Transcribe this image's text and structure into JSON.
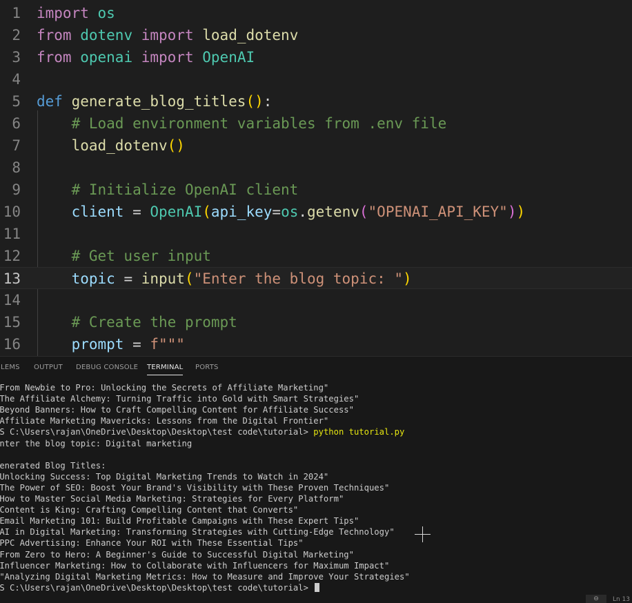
{
  "editor": {
    "current_line": 13,
    "lines": [
      {
        "number": "1",
        "tokens": [
          {
            "t": "import",
            "c": "kw-ctrl"
          },
          {
            "t": " ",
            "c": "op"
          },
          {
            "t": "os",
            "c": "mod"
          }
        ]
      },
      {
        "number": "2",
        "tokens": [
          {
            "t": "from",
            "c": "kw-ctrl"
          },
          {
            "t": " ",
            "c": "op"
          },
          {
            "t": "dotenv",
            "c": "mod"
          },
          {
            "t": " ",
            "c": "op"
          },
          {
            "t": "import",
            "c": "kw-ctrl"
          },
          {
            "t": " ",
            "c": "op"
          },
          {
            "t": "load_dotenv",
            "c": "fn"
          }
        ]
      },
      {
        "number": "3",
        "tokens": [
          {
            "t": "from",
            "c": "kw-ctrl"
          },
          {
            "t": " ",
            "c": "op"
          },
          {
            "t": "openai",
            "c": "mod"
          },
          {
            "t": " ",
            "c": "op"
          },
          {
            "t": "import",
            "c": "kw-ctrl"
          },
          {
            "t": " ",
            "c": "op"
          },
          {
            "t": "OpenAI",
            "c": "mod"
          }
        ]
      },
      {
        "number": "4",
        "tokens": []
      },
      {
        "number": "5",
        "tokens": [
          {
            "t": "def",
            "c": "kw-def"
          },
          {
            "t": " ",
            "c": "op"
          },
          {
            "t": "generate_blog_titles",
            "c": "fn"
          },
          {
            "t": "()",
            "c": "br1"
          },
          {
            "t": ":",
            "c": "op"
          }
        ]
      },
      {
        "number": "6",
        "tokens": [
          {
            "t": "    ",
            "c": "op"
          },
          {
            "t": "# Load environment variables from .env file",
            "c": "cmt"
          }
        ]
      },
      {
        "number": "7",
        "tokens": [
          {
            "t": "    ",
            "c": "op"
          },
          {
            "t": "load_dotenv",
            "c": "fn"
          },
          {
            "t": "()",
            "c": "br1"
          }
        ]
      },
      {
        "number": "8",
        "tokens": []
      },
      {
        "number": "9",
        "tokens": [
          {
            "t": "    ",
            "c": "op"
          },
          {
            "t": "# Initialize OpenAI client",
            "c": "cmt"
          }
        ]
      },
      {
        "number": "10",
        "tokens": [
          {
            "t": "    ",
            "c": "op"
          },
          {
            "t": "client",
            "c": "var"
          },
          {
            "t": " = ",
            "c": "op"
          },
          {
            "t": "OpenAI",
            "c": "mod"
          },
          {
            "t": "(",
            "c": "br1"
          },
          {
            "t": "api_key",
            "c": "var"
          },
          {
            "t": "=",
            "c": "op"
          },
          {
            "t": "os",
            "c": "mod"
          },
          {
            "t": ".",
            "c": "op"
          },
          {
            "t": "getenv",
            "c": "fn"
          },
          {
            "t": "(",
            "c": "br2"
          },
          {
            "t": "\"OPENAI_API_KEY\"",
            "c": "str"
          },
          {
            "t": ")",
            "c": "br2"
          },
          {
            "t": ")",
            "c": "br1"
          }
        ]
      },
      {
        "number": "11",
        "tokens": []
      },
      {
        "number": "12",
        "tokens": [
          {
            "t": "    ",
            "c": "op"
          },
          {
            "t": "# Get user input",
            "c": "cmt"
          }
        ]
      },
      {
        "number": "13",
        "tokens": [
          {
            "t": "    ",
            "c": "op"
          },
          {
            "t": "topic",
            "c": "var"
          },
          {
            "t": " = ",
            "c": "op"
          },
          {
            "t": "input",
            "c": "fn"
          },
          {
            "t": "(",
            "c": "br1"
          },
          {
            "t": "\"Enter the blog topic: \"",
            "c": "str"
          },
          {
            "t": ")",
            "c": "br1"
          }
        ]
      },
      {
        "number": "14",
        "tokens": []
      },
      {
        "number": "15",
        "tokens": [
          {
            "t": "    ",
            "c": "op"
          },
          {
            "t": "# Create the prompt",
            "c": "cmt"
          }
        ]
      },
      {
        "number": "16",
        "tokens": [
          {
            "t": "    ",
            "c": "op"
          },
          {
            "t": "prompt",
            "c": "var"
          },
          {
            "t": " = ",
            "c": "op"
          },
          {
            "t": "f\"\"\"",
            "c": "str"
          }
        ]
      }
    ]
  },
  "panel": {
    "tabs": [
      {
        "label": "BLEMS",
        "active": false,
        "name": "tab-problems"
      },
      {
        "label": "OUTPUT",
        "active": false,
        "name": "tab-output"
      },
      {
        "label": "DEBUG CONSOLE",
        "active": false,
        "name": "tab-debug-console"
      },
      {
        "label": "TERMINAL",
        "active": true,
        "name": "tab-terminal"
      },
      {
        "label": "PORTS",
        "active": false,
        "name": "tab-ports"
      }
    ],
    "terminal_lines": [
      {
        "text": "\"From Newbie to Pro: Unlocking the Secrets of Affiliate Marketing\""
      },
      {
        "text": "\"The Affiliate Alchemy: Turning Traffic into Gold with Smart Strategies\""
      },
      {
        "text": "\"Beyond Banners: How to Craft Compelling Content for Affiliate Success\""
      },
      {
        "text": "\"Affiliate Marketing Mavericks: Lessons from the Digital Frontier\""
      },
      {
        "text": "PS C:\\Users\\rajan\\OneDrive\\Desktop\\Desktop\\test code\\tutorial> ",
        "cmd": "python tutorial.py"
      },
      {
        "text": "Enter the blog topic: Digital marketing"
      },
      {
        "text": ""
      },
      {
        "text": "Generated Blog Titles:"
      },
      {
        "text": "\"Unlocking Success: Top Digital Marketing Trends to Watch in 2024\""
      },
      {
        "text": "\"The Power of SEO: Boost Your Brand's Visibility with These Proven Techniques\""
      },
      {
        "text": "\"How to Master Social Media Marketing: Strategies for Every Platform\""
      },
      {
        "text": "\"Content is King: Crafting Compelling Content that Converts\""
      },
      {
        "text": "\"Email Marketing 101: Build Profitable Campaigns with These Expert Tips\""
      },
      {
        "text": "\"AI in Digital Marketing: Transforming Strategies with Cutting-Edge Technology\""
      },
      {
        "text": "\"PPC Advertising: Enhance Your ROI with These Essential Tips\""
      },
      {
        "text": "\"From Zero to Hero: A Beginner's Guide to Successful Digital Marketing\""
      },
      {
        "text": "\"Influencer Marketing: How to Collaborate with Influencers for Maximum Impact\""
      },
      {
        "text": " \"Analyzing Digital Marketing Metrics: How to Measure and Improve Your Strategies\""
      },
      {
        "text": "PS C:\\Users\\rajan\\OneDrive\\Desktop\\Desktop\\test code\\tutorial> ",
        "cursor": true
      }
    ]
  },
  "status": {
    "bell_icon": "bell-icon",
    "position": "Ln 13"
  },
  "colors": {
    "editor_bg": "#1e1e1e",
    "panel_bg": "#181818",
    "keyword": "#c586c0",
    "def": "#569cd6",
    "function": "#dcdcaa",
    "module": "#4ec9b0",
    "variable": "#9cdcfe",
    "string": "#ce9178",
    "comment": "#6a9955",
    "command": "#e5e510"
  }
}
